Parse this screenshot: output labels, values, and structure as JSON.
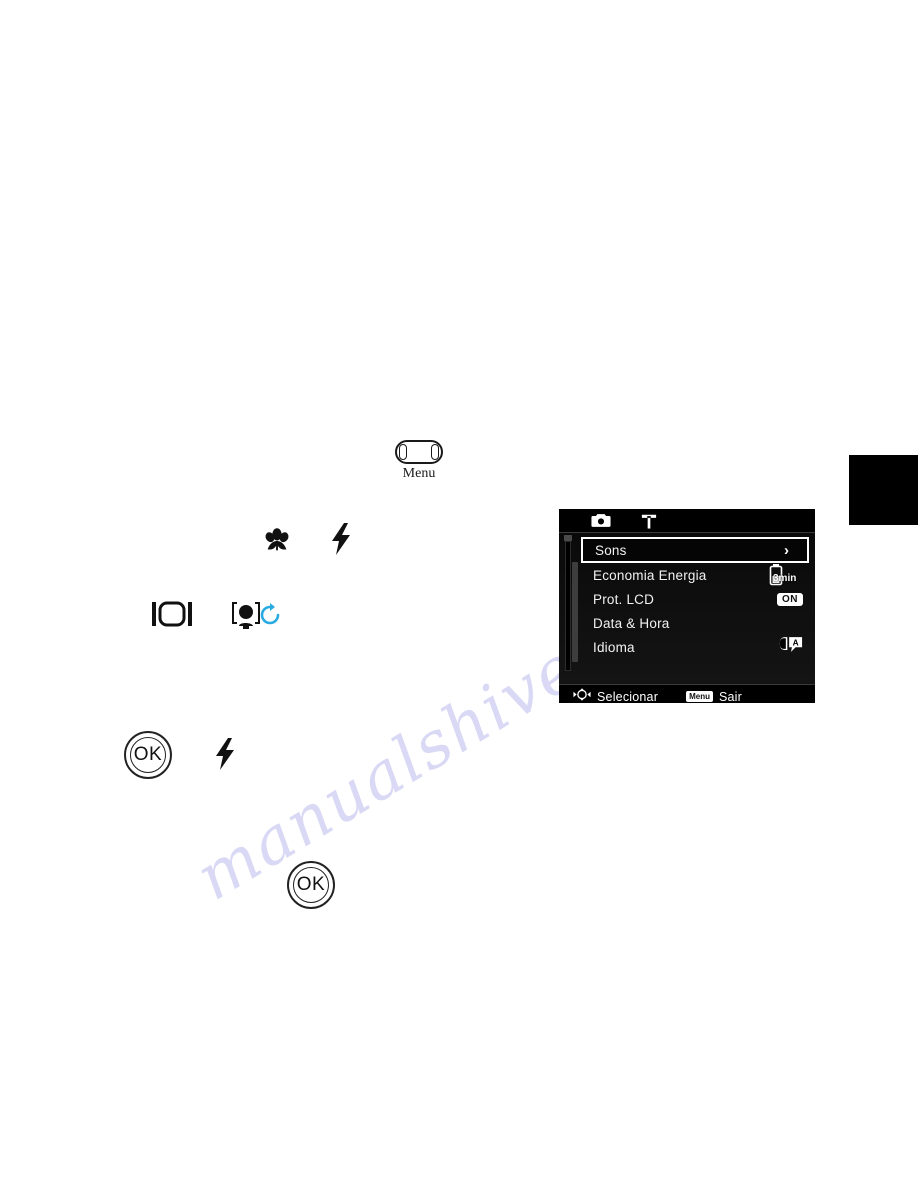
{
  "page": {
    "watermark_text": "manualshive.com",
    "watermark_color": "#d9d9f5",
    "background_color": "#ffffff"
  },
  "edge_tab": {
    "color": "#000000"
  },
  "controls": {
    "menu_button_label": "Menu",
    "ok_button_label": "OK",
    "ok_button_label_2": "OK",
    "icons": {
      "macro": "macro-flower-icon",
      "flash": "flash-bolt-icon",
      "flash_2": "flash-bolt-icon",
      "display": "display-lcd-icon",
      "face_detect": "face-detection-icon",
      "self_timer": "self-timer-icon"
    },
    "timer_icon_color": "#29abe2"
  },
  "lcd": {
    "tabs": [
      {
        "name": "camera-tab",
        "icon": "camera-icon",
        "active": false
      },
      {
        "name": "setup-tab",
        "icon": "hammer-icon",
        "active": true
      }
    ],
    "menu_items": [
      {
        "label": "Sons",
        "value_type": "chevron",
        "value_text": "›",
        "selected": true
      },
      {
        "label": "Economia Energia",
        "value_type": "battery",
        "value_text": "3min",
        "selected": false
      },
      {
        "label": "Prot. LCD",
        "value_type": "badge",
        "value_text": "ON",
        "selected": false
      },
      {
        "label": "Data & Hora",
        "value_type": "none",
        "value_text": "",
        "selected": false
      },
      {
        "label": "Idioma",
        "value_type": "language",
        "value_text": "",
        "selected": false
      }
    ],
    "footer": {
      "select_icon": "four-way-navigation-icon",
      "select_label": "Selecionar",
      "menu_chip_label": "Menu",
      "exit_label": "Sair"
    },
    "colors": {
      "screen_background": "#000000",
      "text": "#ffffff",
      "highlight_border": "#ffffff",
      "badge_background": "#ffffff",
      "badge_text": "#111111"
    }
  }
}
